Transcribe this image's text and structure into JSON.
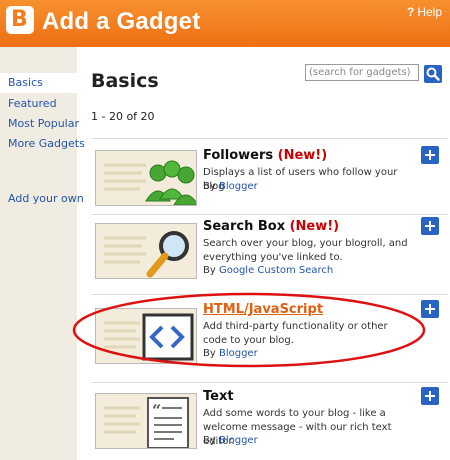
{
  "header": {
    "logo_letter": "B",
    "title": "Add a Gadget",
    "help_icon": "?",
    "help_label": "Help"
  },
  "sidebar": {
    "items": [
      {
        "label": "Basics"
      },
      {
        "label": "Featured"
      },
      {
        "label": "Most Popular"
      },
      {
        "label": "More Gadgets"
      },
      {
        "label": "Add your own"
      }
    ]
  },
  "main": {
    "title": "Basics",
    "count": "1 - 20 of 20",
    "search": {
      "placeholder": "(search for gadgets)"
    }
  },
  "gadgets": [
    {
      "title": "Followers",
      "badge": "(New!)",
      "description": "Displays a list of users who follow your blog",
      "by_label": "By",
      "author": "Blogger",
      "thumb_icon": "followers-icon"
    },
    {
      "title": "Search Box",
      "badge": "(New!)",
      "description": "Search over your blog, your blogroll, and everything you've linked to.",
      "by_label": "By",
      "author": "Google Custom Search",
      "thumb_icon": "magnifier-icon"
    },
    {
      "title": "HTML/JavaScript",
      "badge": "",
      "description": "Add third-party functionality or other code to your blog.",
      "by_label": "By",
      "author": "Blogger",
      "thumb_icon": "code-brackets-icon"
    },
    {
      "title": "Text",
      "badge": "",
      "description": "Add some words to your blog - like a welcome message - with our rich text editor.",
      "by_label": "By",
      "author": "Blogger",
      "thumb_icon": "text-page-icon"
    }
  ],
  "colors": {
    "header_orange": "#f37c1f",
    "link_blue": "#2255aa",
    "new_red": "#cc0000",
    "highlight_red": "#dd1111",
    "add_blue": "#2a64c2"
  }
}
